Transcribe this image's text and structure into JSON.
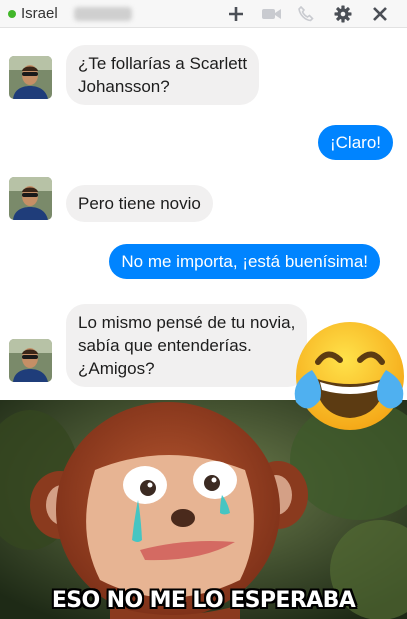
{
  "header": {
    "contact_name": "Israel",
    "status": "online",
    "icons": [
      "plus-icon",
      "video-camera-icon",
      "phone-icon",
      "gear-icon",
      "close-icon"
    ]
  },
  "messages": [
    {
      "from": "contact",
      "lines": [
        "¿Te follarías a Scarlett",
        "Johansson?"
      ]
    },
    {
      "from": "me",
      "text": "¡Claro!"
    },
    {
      "from": "contact",
      "lines": [
        "Pero tiene novio"
      ]
    },
    {
      "from": "me",
      "text": "No me importa, ¡está buenísima!"
    },
    {
      "from": "contact",
      "lines": [
        "Lo mismo pensé de tu novia,",
        "sabía que entenderías.",
        "¿Amigos?"
      ]
    }
  ],
  "meme": {
    "caption": "ESO NO ME LO ESPERABA"
  },
  "colors": {
    "outgoing_bubble": "#0084ff",
    "incoming_bubble": "#f1f0f0",
    "online_dot": "#42b72a"
  }
}
